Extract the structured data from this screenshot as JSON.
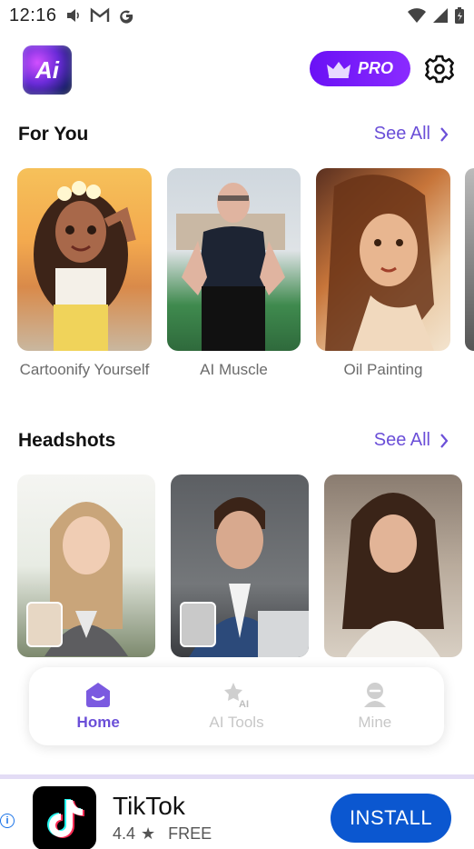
{
  "status_bar": {
    "time": "12:16"
  },
  "header": {
    "pro_label": "PRO",
    "logo_text": "Ai"
  },
  "sections": [
    {
      "title": "For You",
      "see_all": "See All",
      "items": [
        {
          "label": "Cartoonify Yourself"
        },
        {
          "label": "AI Muscle"
        },
        {
          "label": "Oil Painting"
        }
      ]
    },
    {
      "title": "Headshots",
      "see_all": "See All"
    }
  ],
  "bottom_nav": [
    {
      "label": "Home",
      "icon": "home-icon",
      "active": true
    },
    {
      "label": "AI Tools",
      "icon": "ai-tools-icon",
      "active": false
    },
    {
      "label": "Mine",
      "icon": "profile-icon",
      "active": false
    }
  ],
  "ad": {
    "title": "TikTok",
    "rating": "4.4",
    "price": "FREE",
    "install_label": "INSTALL"
  },
  "colors": {
    "accent": "#6b4fd8",
    "pro_gradient_start": "#6a11f5",
    "install_blue": "#0b57d0"
  }
}
